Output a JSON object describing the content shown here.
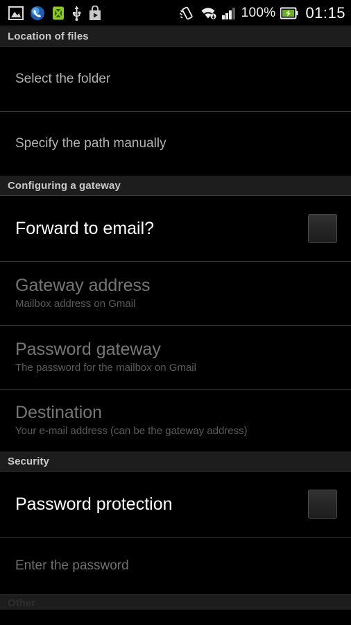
{
  "status_bar": {
    "left_icons": [
      {
        "name": "screenshot-image-icon",
        "glyph": "image"
      },
      {
        "name": "phone-call-icon",
        "glyph": "phone"
      },
      {
        "name": "android-robot-icon",
        "glyph": "android"
      },
      {
        "name": "usb-icon",
        "glyph": "usb"
      },
      {
        "name": "play-store-icon",
        "glyph": "store"
      }
    ],
    "right_icons": [
      {
        "name": "vibrate-icon",
        "glyph": "vibrate"
      },
      {
        "name": "wifi-icon",
        "glyph": "wifi"
      },
      {
        "name": "cellular-signal-icon",
        "glyph": "signal"
      }
    ],
    "battery_percent": "100%",
    "battery_icon_name": "battery-charging-icon",
    "clock": "01:15"
  },
  "sections": [
    {
      "header": "Location of files",
      "rows": [
        {
          "name": "select-the-folder",
          "title": "Select the folder",
          "summary": "",
          "enabled": true,
          "style": "medium",
          "has_checkbox": false,
          "checked": false
        },
        {
          "name": "specify-the-path-manually",
          "title": "Specify the path manually",
          "summary": "",
          "enabled": true,
          "style": "medium",
          "has_checkbox": false,
          "checked": false
        }
      ]
    },
    {
      "header": "Configuring a gateway",
      "rows": [
        {
          "name": "forward-to-email",
          "title": "Forward to email?",
          "summary": "",
          "enabled": true,
          "style": "large",
          "has_checkbox": true,
          "checked": false
        },
        {
          "name": "gateway-address",
          "title": "Gateway address",
          "summary": "Mailbox address on Gmail",
          "enabled": false,
          "style": "large",
          "has_checkbox": false,
          "checked": false
        },
        {
          "name": "password-gateway",
          "title": "Password gateway",
          "summary": "The password for the mailbox on Gmail",
          "enabled": false,
          "style": "large",
          "has_checkbox": false,
          "checked": false
        },
        {
          "name": "destination",
          "title": "Destination",
          "summary": "Your e-mail address (can be the gateway address)",
          "enabled": false,
          "style": "large",
          "has_checkbox": false,
          "checked": false
        }
      ]
    },
    {
      "header": "Security",
      "rows": [
        {
          "name": "password-protection",
          "title": "Password protection",
          "summary": "",
          "enabled": true,
          "style": "large",
          "has_checkbox": true,
          "checked": false
        },
        {
          "name": "enter-the-password",
          "title": "Enter the password",
          "summary": "",
          "enabled": false,
          "style": "medium",
          "has_checkbox": false,
          "checked": false
        }
      ]
    }
  ],
  "partial_footer_section": {
    "header": "Other"
  },
  "colors": {
    "background": "#000000",
    "section_header_bg": "#1d1d1d",
    "section_header_text": "#c9c9c9",
    "divider": "#383838",
    "text_enabled": "#ffffff",
    "text_medium": "#b2b2b2",
    "text_disabled": "#767676",
    "summary_disabled": "#5b5b5b",
    "battery_green": "#6ab023"
  }
}
